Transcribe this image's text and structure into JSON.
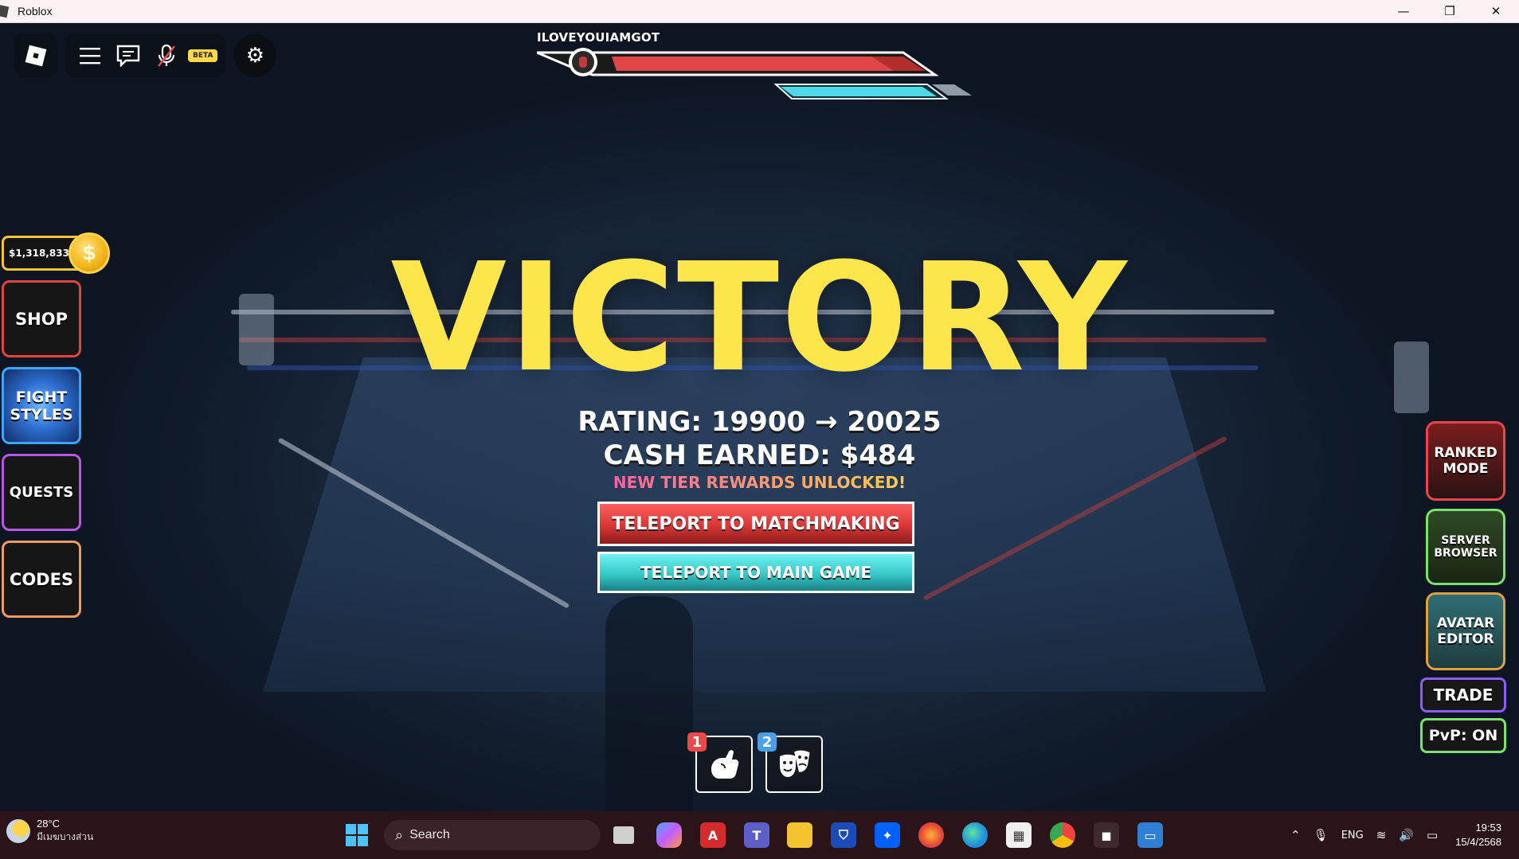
{
  "window": {
    "title": "Roblox",
    "controls": {
      "minimize": "—",
      "maximize": "❐",
      "close": "✕"
    }
  },
  "roblox_menu": {
    "icons": [
      "roblox-logo-icon",
      "hamburger-menu-icon",
      "chat-icon",
      "microphone-muted-icon",
      "gear-icon"
    ],
    "beta_label": "BETA"
  },
  "player": {
    "name": "ILOVEYOUIAMGOT",
    "health_fraction": 1.0,
    "stamina_fraction": 1.0
  },
  "currency": {
    "amount": "$1,318,833",
    "coin_symbol": "$"
  },
  "left_menu": [
    {
      "label": "SHOP",
      "border": "#e0443b"
    },
    {
      "label": "FIGHT STYLES",
      "border": "#3da4ff"
    },
    {
      "label": "QUESTS",
      "border": "#b657e8"
    },
    {
      "label": "CODES",
      "border": "#f19a5a"
    }
  ],
  "right_menu": {
    "ranked_mode": "RANKED MODE",
    "server_browser": "SERVER BROWSER",
    "avatar_editor": "AVATAR EDITOR",
    "trade": "TRADE",
    "pvp": "PvP: ON"
  },
  "result": {
    "headline": "VICTORY",
    "rating": "RATING: 19900 → 20025",
    "cash": "CASH EARNED: $484",
    "tier_notice": "NEW TIER REWARDS UNLOCKED!",
    "teleport_matchmaking": "TELEPORT TO MATCHMAKING",
    "teleport_main": "TELEPORT TO MAIN GAME"
  },
  "hotbar": [
    {
      "key": "1",
      "icon": "fist-icon",
      "badge_color": "#e8494a"
    },
    {
      "key": "2",
      "icon": "theater-masks-icon",
      "badge_color": "#4a9fe8"
    }
  ],
  "colors": {
    "victory_yellow": "#fde64b",
    "health_red": "#e04444",
    "stamina_cyan": "#4dd9e8"
  },
  "taskbar": {
    "weather_temp": "28°C",
    "weather_desc": "มีเมฆบางส่วน",
    "search_label": "Search",
    "language": "ENG",
    "time": "19:53",
    "date": "15/4/2568"
  }
}
